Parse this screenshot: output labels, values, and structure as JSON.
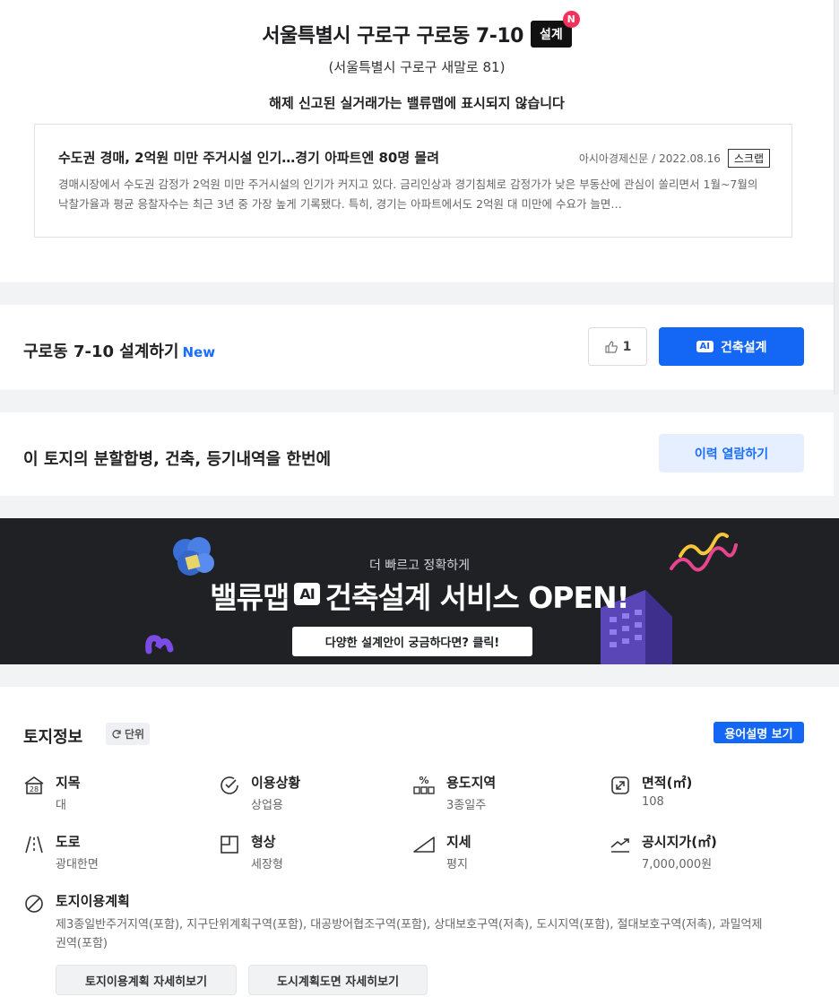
{
  "header": {
    "address": "서울특별시 구로구 구로동 7-10",
    "design_badge": "설계",
    "new_badge": "N",
    "road_address": "(서울특별시 구로구 새말로 81)",
    "notice": "해제 신고된 실거래가는 밸류맵에 표시되지 않습니다"
  },
  "news": {
    "title": "수도권 경매, 2억원 미만 주거시설 인기…경기 아파트엔 80명 몰려",
    "source": "아시아경제신문",
    "separator": "/",
    "date": "2022.08.16",
    "scrap_label": "스크랩",
    "body": "경매시장에서 수도권 감정가 2억원 미만 주거시설의 인기가 커지고 있다. 금리인상과 경기침체로 감정가가 낮은 부동산에 관심이 쏠리면서 1월~7월의 낙찰가율과 평균 응찰자수는 최근 3년 중 가장 높게 기록됐다. 특히, 경기는 아파트에서도 2억원 대 미만에 수요가 늘면…"
  },
  "design": {
    "title": "구로동 7-10 설계하기",
    "new_tag": "New",
    "like_count": "1",
    "ai_chip": "AI",
    "ai_button_label": "건축설계"
  },
  "history": {
    "title": "이 토지의 분할합병, 건축, 등기내역을 한번에",
    "button_label": "이력 열람하기"
  },
  "banner": {
    "subtitle": "더 빠르고 정확하게",
    "title_left": "밸류맵",
    "ai_chip": "AI",
    "title_right": "건축설계 서비스 OPEN!",
    "cta": "다양한 설계안이 궁금하다면? 클릭!"
  },
  "land": {
    "title": "토지정보",
    "unit_label": "단위",
    "glossary_label": "용어설명 보기",
    "items": [
      {
        "label": "지목",
        "value": "대",
        "icon": "land-category-icon",
        "icon_text": "28"
      },
      {
        "label": "이용상황",
        "value": "상업용",
        "icon": "usage-check-icon"
      },
      {
        "label": "용도지역",
        "value": "3종일주",
        "icon": "zoning-percent-icon"
      },
      {
        "label": "면적(㎡)",
        "value": "108",
        "icon": "area-expand-icon"
      },
      {
        "label": "도로",
        "value": "광대한면",
        "icon": "road-icon"
      },
      {
        "label": "형상",
        "value": "세장형",
        "icon": "shape-icon"
      },
      {
        "label": "지세",
        "value": "평지",
        "icon": "terrain-icon"
      },
      {
        "label": "공시지가(㎡)",
        "value": "7,000,000원",
        "icon": "price-trend-icon"
      }
    ],
    "plan": {
      "label": "토지이용계획",
      "value": "제3종일반주거지역(포함), 지구단위계획구역(포함), 대공방어협조구역(포함), 상대보호구역(저촉), 도시지역(포함), 절대보호구역(저촉), 과밀억제권역(포함)",
      "icon": "restricted-icon"
    },
    "plan_detail_button": "토지이용계획 자세히보기",
    "city_plan_button": "도시계획도면 자세히보기"
  },
  "colors": {
    "primary": "#1467f5",
    "new_badge": "#f2325a",
    "banner_bg": "#1f2125",
    "history_btn_bg": "#e6efff"
  }
}
